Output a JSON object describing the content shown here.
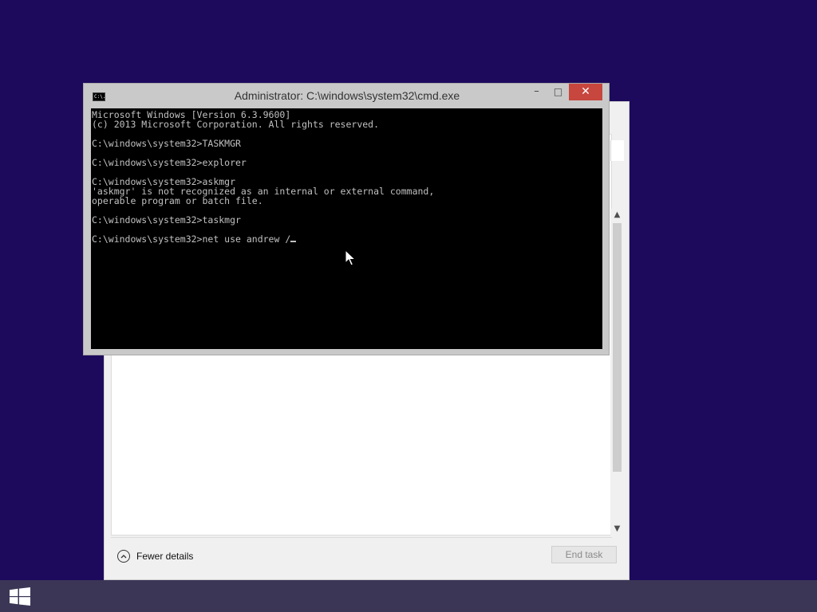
{
  "console": {
    "title": "Administrator: C:\\windows\\system32\\cmd.exe",
    "icon": "console-icon",
    "icon_text": "C:\\.",
    "lines": [
      "Microsoft Windows [Version 6.3.9600]",
      "(c) 2013 Microsoft Corporation. All rights reserved.",
      "",
      "C:\\windows\\system32>TASKMGR",
      "",
      "C:\\windows\\system32>explorer",
      "",
      "C:\\windows\\system32>askmgr",
      "'askmgr' is not recognized as an internal or external command,",
      "operable program or batch file.",
      "",
      "C:\\windows\\system32>taskmgr",
      ""
    ],
    "current_input": "C:\\windows\\system32>net use andrew /",
    "controls": {
      "minimize": "–",
      "maximize": "□",
      "close": "✕"
    }
  },
  "task_manager": {
    "fewer_details_label": "Fewer details",
    "end_task_label": "End task"
  },
  "colors": {
    "desktop": "#1d0a5c",
    "taskbar": "#3c3656",
    "close_button": "#c7463e"
  }
}
